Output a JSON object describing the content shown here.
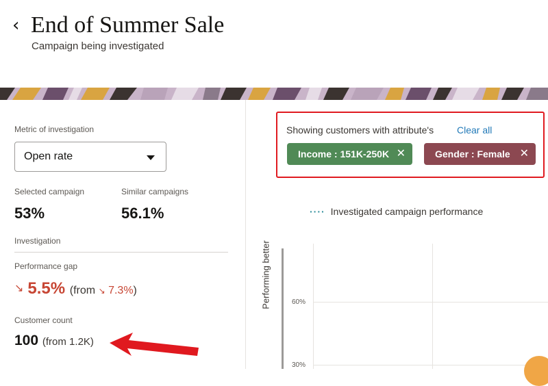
{
  "header": {
    "back_icon": "chevron-left-icon",
    "title": "End of Summer Sale",
    "subtitle": "Campaign being investigated"
  },
  "metric": {
    "label": "Metric of investigation",
    "selected": "Open rate"
  },
  "stats": {
    "selected_label": "Selected campaign",
    "selected_value": "53%",
    "similar_label": "Similar campaigns",
    "similar_value": "56.1%"
  },
  "investigation": {
    "section_label": "Investigation",
    "gap_label": "Performance gap",
    "gap_value": "5.5%",
    "gap_from_prefix": "(from",
    "gap_from_value": "7.3%",
    "gap_from_suffix": ")",
    "count_label": "Customer count",
    "count_value": "100",
    "count_from": "(from 1.2K)"
  },
  "filters": {
    "label": "Showing customers with attribute's",
    "clear_all": "Clear all",
    "chips": [
      {
        "label": "Income : 151K-250K",
        "color": "#508a56"
      },
      {
        "label": "Gender : Female",
        "color": "#8c4851"
      }
    ]
  },
  "chart": {
    "legend": "Investigated campaign performance",
    "y_axis_label": "Performing better",
    "ticks": [
      "60%",
      "30%"
    ]
  },
  "colors": {
    "negative": "#c74634",
    "link": "#227ab8",
    "highlight_box": "#e0191f"
  }
}
